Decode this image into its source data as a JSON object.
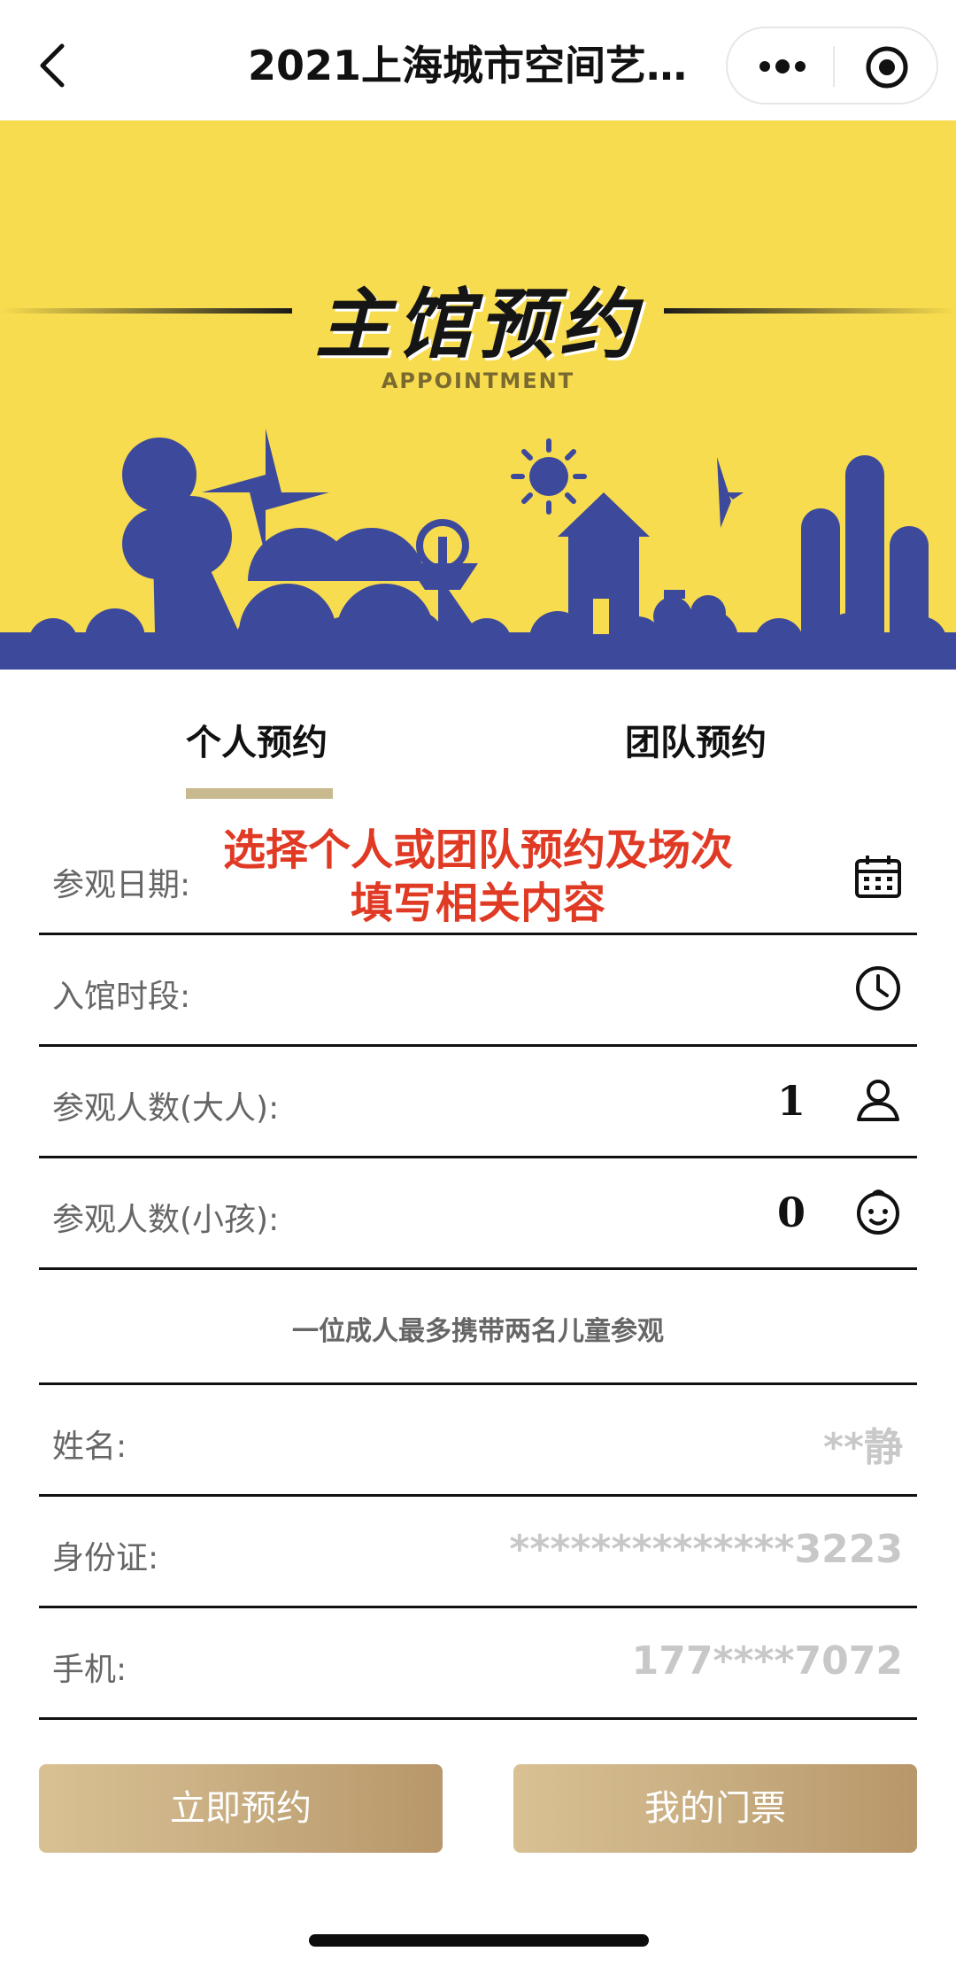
{
  "nav": {
    "title": "2021上海城市空间艺…"
  },
  "banner": {
    "title": "主馆预约",
    "subtitle": "APPOINTMENT"
  },
  "tabs": [
    {
      "label": "个人预约",
      "active": true
    },
    {
      "label": "团队预约",
      "active": false
    }
  ],
  "overlay_note": [
    "选择个人或团队预约及场次",
    "填写相关内容"
  ],
  "form": {
    "visit_date": {
      "label": "参观日期:",
      "value": "",
      "icon": "calendar-icon"
    },
    "entry_period": {
      "label": "入馆时段:",
      "value": "",
      "icon": "clock-icon"
    },
    "adults": {
      "label": "参观人数(大人):",
      "value": "1",
      "icon": "person-icon"
    },
    "children": {
      "label": "参观人数(小孩):",
      "value": "0",
      "icon": "baby-icon"
    },
    "notice": "一位成人最多携带两名儿童参观",
    "name": {
      "label": "姓名:",
      "value": "**静"
    },
    "id_card": {
      "label": "身份证:",
      "value": "**************3223"
    },
    "phone": {
      "label": "手机:",
      "value": "177****7072"
    }
  },
  "buttons": {
    "book": "立即预约",
    "my_tickets": "我的门票"
  },
  "colors": {
    "banner_bg": "#f8dc4f",
    "illustration": "#3d4a9c",
    "accent_gold": "#c9b98e",
    "overlay_red": "#e03a25"
  }
}
